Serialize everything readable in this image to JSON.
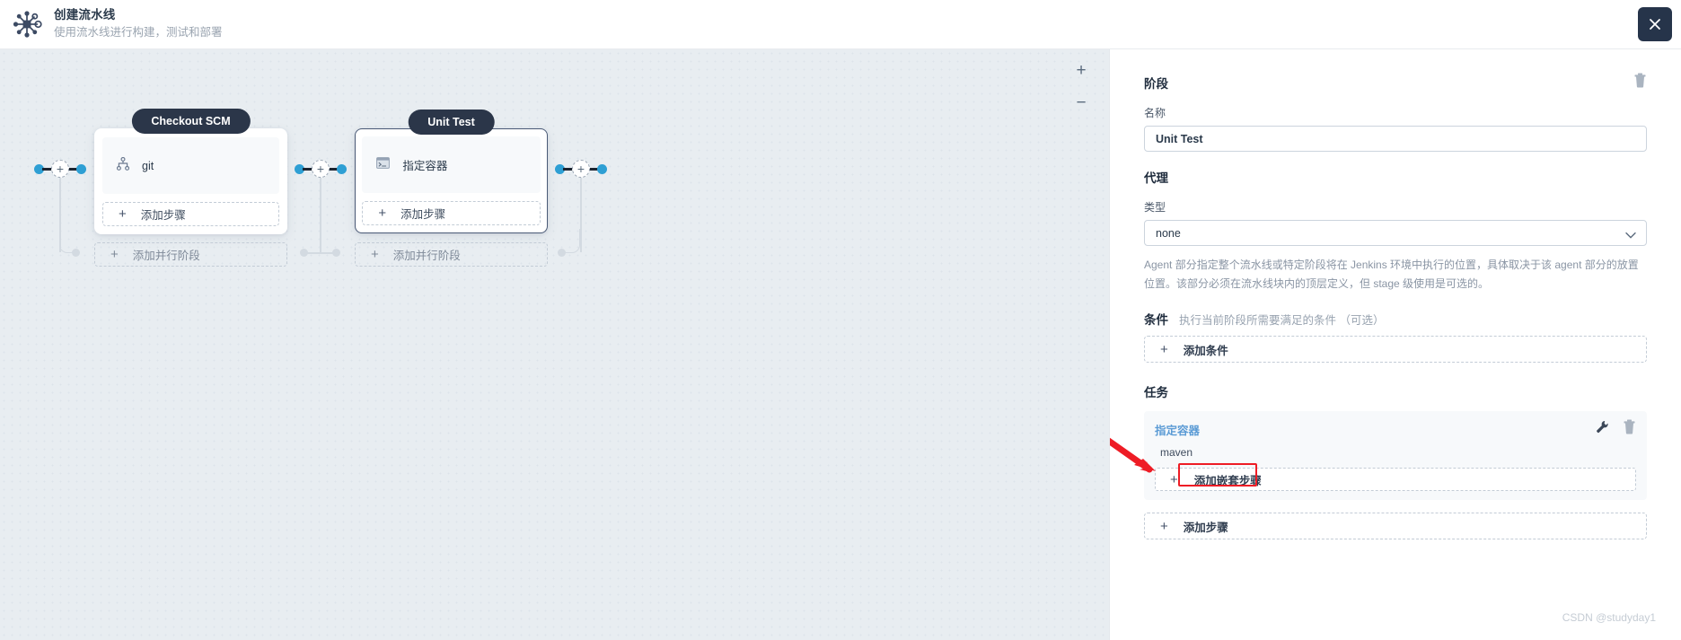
{
  "header": {
    "icon": "pipeline-node-icon",
    "title": "创建流水线",
    "subtitle": "使用流水线进行构建，测试和部署",
    "close_label": "✕"
  },
  "canvas": {
    "zoom_in_label": "+",
    "zoom_out_label": "−",
    "connector_plus_label": "+",
    "stages": [
      {
        "name": "Checkout SCM",
        "selected": false,
        "steps": [
          {
            "icon": "git-branch-icon",
            "label": "git"
          }
        ],
        "add_step_label": "添加步骤",
        "add_parallel_label": "添加并行阶段"
      },
      {
        "name": "Unit Test",
        "selected": true,
        "steps": [
          {
            "icon": "terminal-icon",
            "label": "指定容器"
          }
        ],
        "add_step_label": "添加步骤",
        "add_parallel_label": "添加并行阶段"
      }
    ]
  },
  "sidebar": {
    "stage_section": {
      "title": "阶段",
      "delete_icon": "trash-icon",
      "name_label": "名称",
      "name_value": "Unit Test"
    },
    "agent_section": {
      "title": "代理",
      "type_label": "类型",
      "type_value": "none",
      "chevron_icon": "chevron-down-icon",
      "help_text": "Agent 部分指定整个流水线或特定阶段将在 Jenkins 环境中执行的位置，具体取决于该 agent 部分的放置位置。该部分必须在流水线块内的顶层定义，但 stage 级使用是可选的。"
    },
    "condition_section": {
      "title": "条件",
      "hint": "执行当前阶段所需要满足的条件 （可选）",
      "add_label": "添加条件",
      "plus": "+"
    },
    "task_section": {
      "title": "任务",
      "task_name": "指定容器",
      "task_value": "maven",
      "edit_icon": "wrench-icon",
      "delete_icon": "trash-icon",
      "add_nested_label": "添加嵌套步骤",
      "add_step_label": "添加步骤",
      "plus": "+"
    },
    "highlight_color": "#ee1c25",
    "watermark": "CSDN @studyday1"
  }
}
